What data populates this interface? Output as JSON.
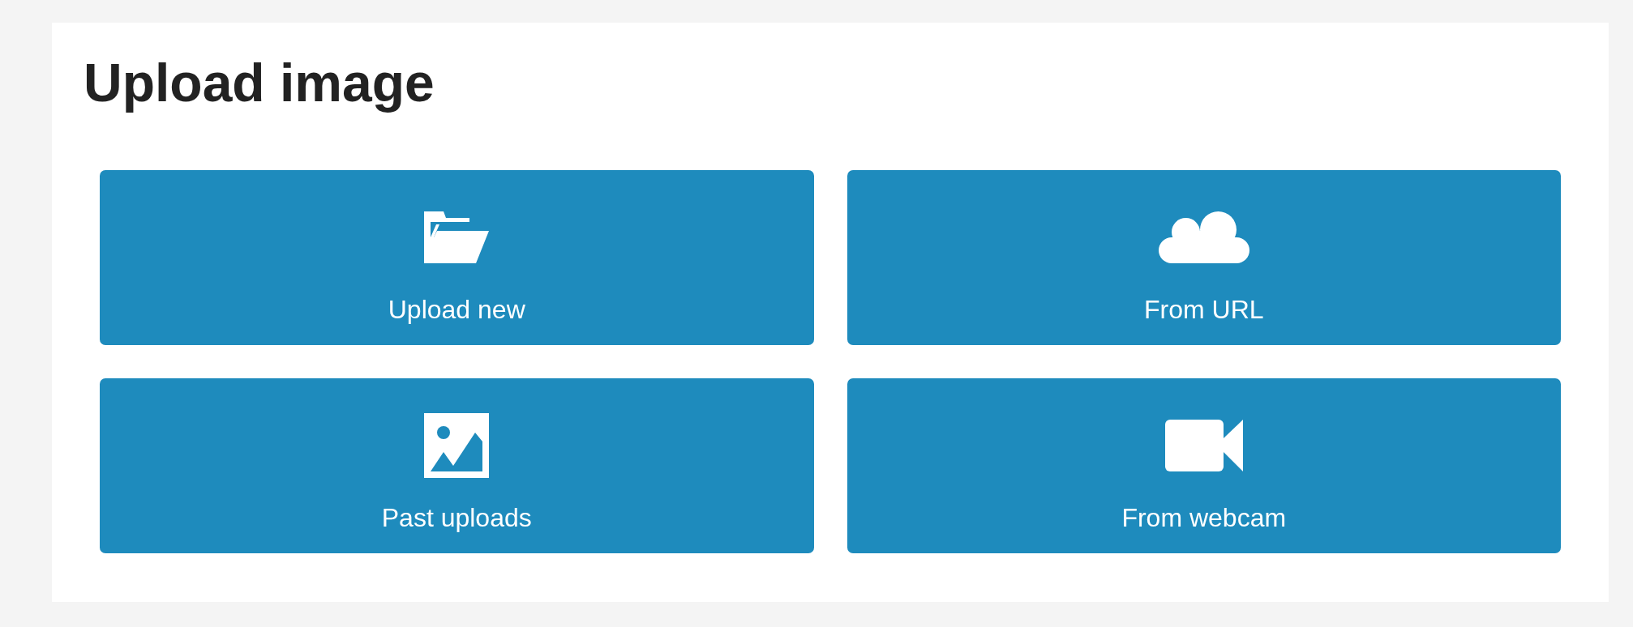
{
  "title": "Upload image",
  "options": [
    {
      "kind": "folder",
      "label": "Upload new"
    },
    {
      "kind": "cloud",
      "label": "From URL"
    },
    {
      "kind": "image",
      "label": "Past uploads"
    },
    {
      "kind": "webcam",
      "label": "From webcam"
    }
  ]
}
